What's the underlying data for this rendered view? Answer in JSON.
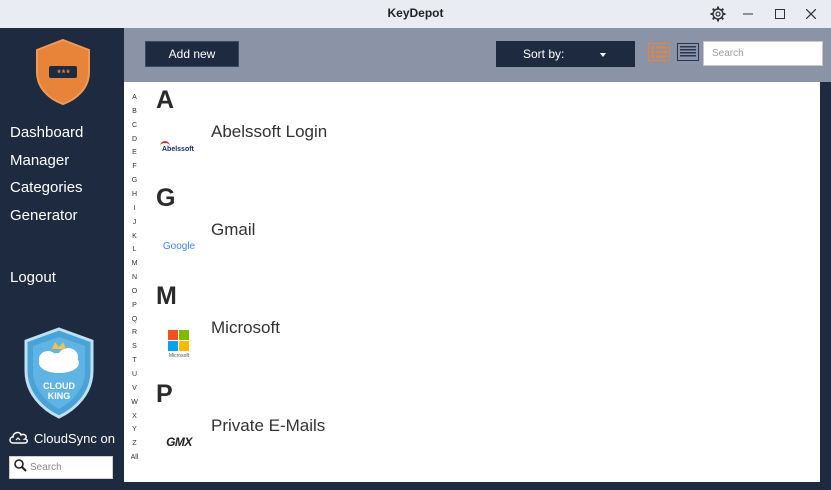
{
  "window": {
    "title": "KeyDepot"
  },
  "sidebar": {
    "logo_text": "***",
    "nav": [
      {
        "label": "Dashboard"
      },
      {
        "label": "Manager"
      },
      {
        "label": "Categories"
      },
      {
        "label": "Generator"
      }
    ],
    "logout": "Logout",
    "badge": {
      "line1": "CLOUD",
      "line2": "KING"
    },
    "cloudsync": "CloudSync on",
    "search_placeholder": "Search"
  },
  "toolbar": {
    "add_label": "Add new",
    "sort_label": "Sort by:",
    "search_placeholder": "Search"
  },
  "alphabet": [
    "A",
    "B",
    "C",
    "D",
    "E",
    "F",
    "G",
    "H",
    "I",
    "J",
    "K",
    "L",
    "M",
    "N",
    "O",
    "P",
    "Q",
    "R",
    "S",
    "T",
    "U",
    "V",
    "W",
    "X",
    "Y",
    "Z",
    "All"
  ],
  "sections": [
    {
      "letter": "A",
      "entries": [
        {
          "name": "Abelssoft Login",
          "logo_text": "Abelssoft",
          "icon": "abelssoft-logo"
        }
      ]
    },
    {
      "letter": "G",
      "entries": [
        {
          "name": "Gmail",
          "logo_text": "Google",
          "icon": "google-logo"
        }
      ]
    },
    {
      "letter": "M",
      "entries": [
        {
          "name": "Microsoft",
          "logo_text": "Microsoft",
          "icon": "microsoft-logo"
        }
      ]
    },
    {
      "letter": "P",
      "entries": [
        {
          "name": "Private E-Mails",
          "logo_text": "GMX",
          "icon": "gmx-logo"
        }
      ]
    }
  ],
  "colors": {
    "sidebar_bg": "#1e2a40",
    "toolbar_bg": "#8b93a7",
    "accent": "#e8833a"
  }
}
